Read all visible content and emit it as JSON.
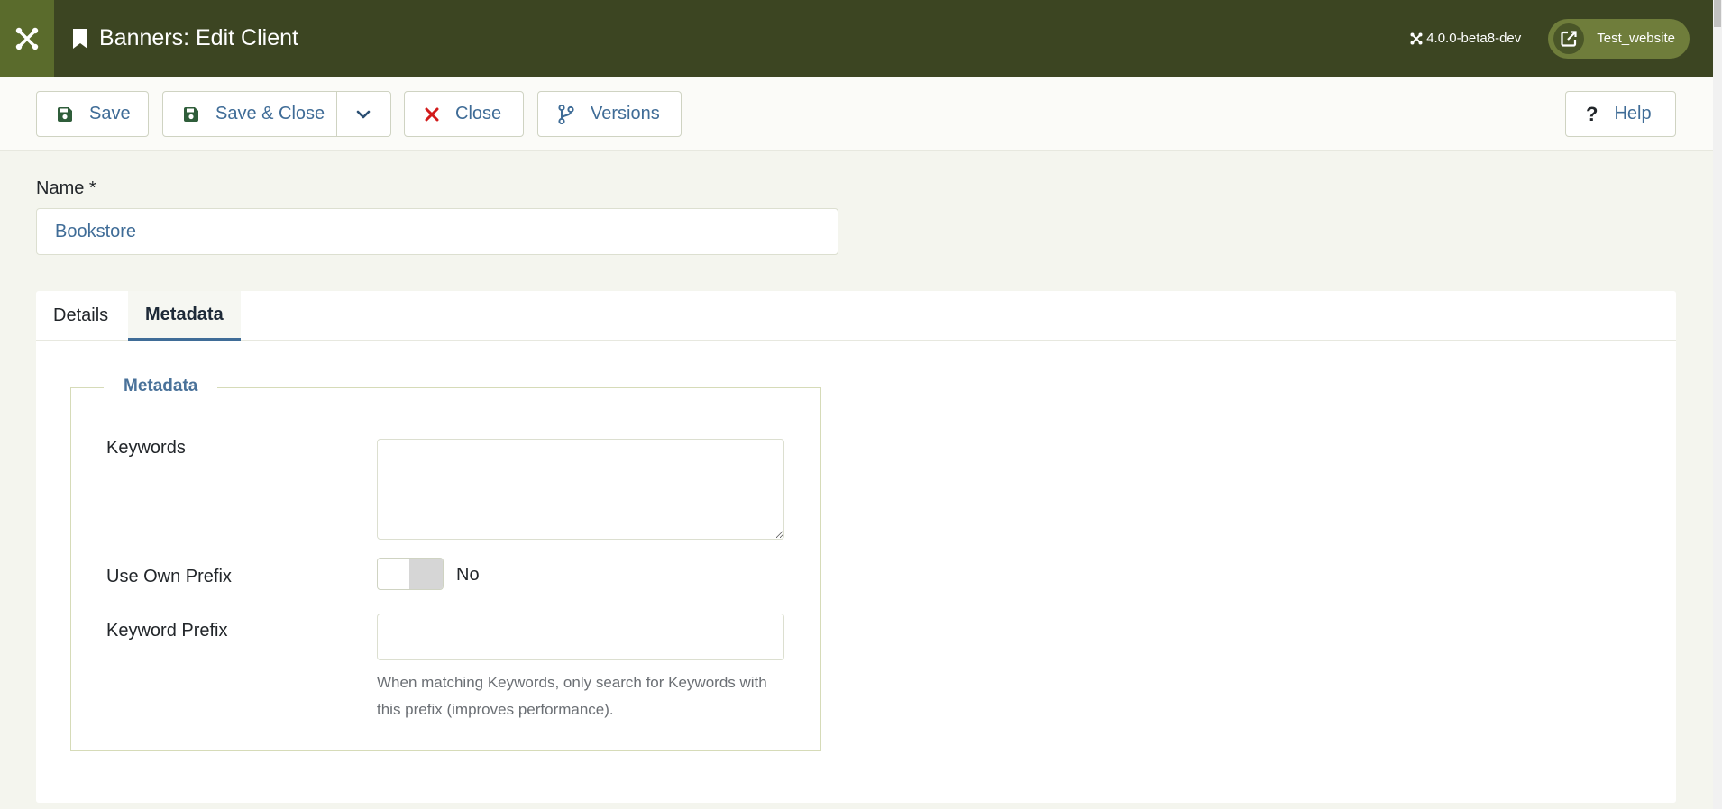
{
  "header": {
    "title": "Banners: Edit Client",
    "version": "4.0.0-beta8-dev",
    "site_link": "Test_website"
  },
  "toolbar": {
    "save": "Save",
    "save_close": "Save & Close",
    "close": "Close",
    "versions": "Versions",
    "help": "Help"
  },
  "form": {
    "name_label": "Name *",
    "name_value": "Bookstore"
  },
  "tabs": [
    {
      "label": "Details",
      "active": false
    },
    {
      "label": "Metadata",
      "active": true
    }
  ],
  "metadata": {
    "legend": "Metadata",
    "keywords_label": "Keywords",
    "keywords_value": "",
    "use_own_prefix_label": "Use Own Prefix",
    "use_own_prefix_value": "No",
    "keyword_prefix_label": "Keyword Prefix",
    "keyword_prefix_value": "",
    "keyword_prefix_help": "When matching Keywords, only search for Keywords with this prefix (improves performance)."
  },
  "colors": {
    "header_bg": "#3c4522",
    "accent": "#3f6c97",
    "close_red": "#d21b1b",
    "save_green": "#2f5d3a"
  }
}
